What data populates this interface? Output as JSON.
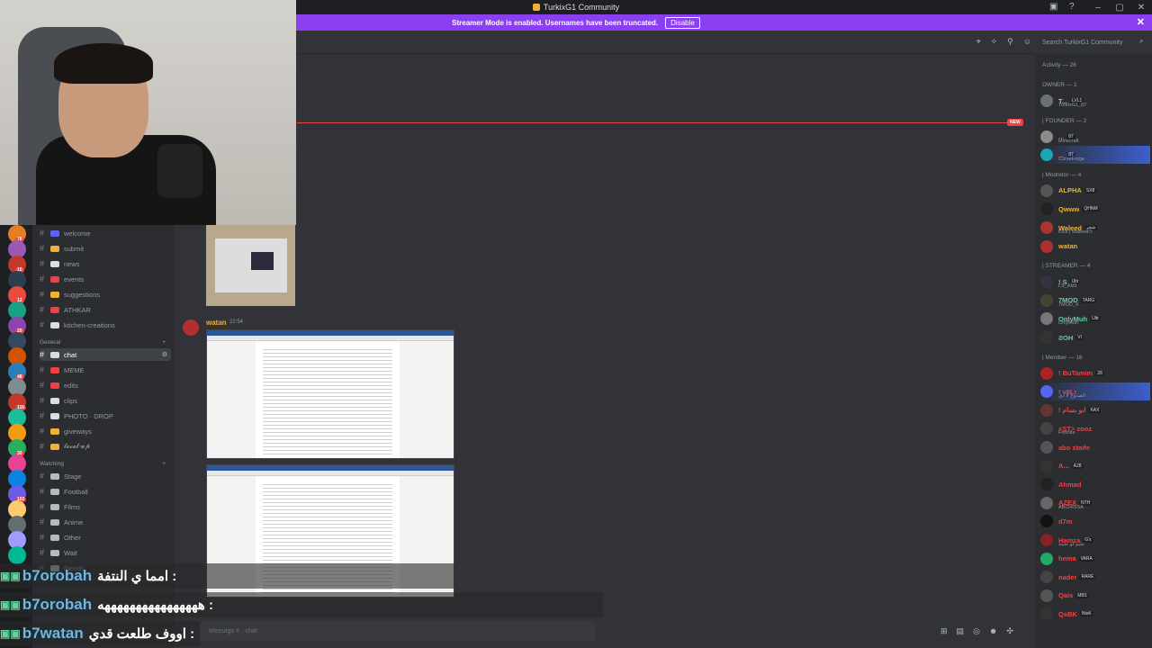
{
  "window": {
    "title": "TurkixG1 Community"
  },
  "banner": {
    "text": "Streamer Mode is enabled. Usernames have been truncated.",
    "button": "Disable"
  },
  "header": {
    "search_placeholder": "Search TurkixG1 Community"
  },
  "server_badges": [
    "78",
    "10",
    "12",
    "20",
    "48",
    "116",
    "30",
    "102"
  ],
  "channels": [
    {
      "name": "welcome",
      "color": "#5865f2"
    },
    {
      "name": "submit",
      "color": "#f0b232"
    },
    {
      "name": "news",
      "color": "#dbdee1"
    },
    {
      "name": "events",
      "color": "#f23f43"
    },
    {
      "name": "suggestions",
      "color": "#f0b232"
    },
    {
      "name": "ATHKAR",
      "color": "#f23f43"
    },
    {
      "name": "kitchen-creations",
      "color": "#dbdee1"
    }
  ],
  "category_general": "General",
  "general_channels": [
    {
      "name": "chat",
      "color": "#dbdee1",
      "active": true
    },
    {
      "name": "MEME",
      "color": "#f23f43"
    },
    {
      "name": "edits",
      "color": "#f23f43"
    },
    {
      "name": "clips",
      "color": "#dbdee1"
    },
    {
      "name": "PHOTO · DROP",
      "color": "#dbdee1"
    },
    {
      "name": "giveways",
      "color": "#f0b232"
    },
    {
      "name": "𝓵𝓮𝓿𝓮𝓵-𝓾𝓹",
      "color": "#f0b232"
    }
  ],
  "category_watching": "Watching",
  "watching_channels": [
    {
      "name": "Stage"
    },
    {
      "name": "Football"
    },
    {
      "name": "Films"
    },
    {
      "name": "Anime"
    },
    {
      "name": "Other"
    },
    {
      "name": "Wait"
    },
    {
      "name": "friends"
    }
  ],
  "message": {
    "author": "watan",
    "time": "22:54"
  },
  "new_badge": "NEW",
  "input_placeholder": "Message #  · chat",
  "members": {
    "activity": "Activity — 26",
    "groups": [
      {
        "label": "OWNER — 1",
        "members": [
          {
            "name": "T...",
            "tag": "LVL1",
            "sub": "TurkixG1_87",
            "color": "#b5bac1",
            "avatar": "#6d6f78"
          }
        ]
      },
      {
        "label": "| FOUNDER — 2",
        "members": [
          {
            "name": "...",
            "tag": "87",
            "sub": "Minecraft",
            "color": "#f23f43",
            "avatar": "#8a8a8a"
          },
          {
            "name": "...",
            "tag": "87",
            "sub": "CurseForge",
            "color": "#f23f43",
            "avatar": "#1aa5b0",
            "highlight": true
          }
        ]
      },
      {
        "label": "| Modretor — 4",
        "members": [
          {
            "name": "ALPHA",
            "tag": "SX8",
            "sub": "",
            "color": "#f0b232",
            "avatar": "#555"
          },
          {
            "name": "Qwww",
            "tag": "QHNM",
            "sub": "",
            "color": "#f0b232",
            "avatar": "#222"
          },
          {
            "name": "Waleed",
            "tag": "شجر",
            "sub": "Kick | Waleed7i",
            "color": "#f0b232",
            "avatar": "#a33"
          },
          {
            "name": "watan",
            "tag": "",
            "sub": "",
            "color": "#f0b232",
            "avatar": "#b03030"
          }
        ]
      },
      {
        "label": "| STREAMER — 4",
        "members": [
          {
            "name": "! S",
            "tag": "Ultr",
            "sub": "LS_AM1",
            "color": "#5dd39e",
            "avatar": "#334"
          },
          {
            "name": "7MOD",
            "tag": "TARG",
            "sub": "7MOD_4",
            "color": "#5dd39e",
            "avatar": "#443"
          },
          {
            "name": "OnlyMuh",
            "tag": "Ultr",
            "sub": "OnlyMuh",
            "color": "#5dd39e",
            "avatar": "#777"
          },
          {
            "name": "ƧOH",
            "tag": "VI",
            "sub": "",
            "color": "#5dd39e",
            "avatar": "#333"
          }
        ]
      },
      {
        "label": "| Member — 16",
        "members": [
          {
            "name": "! BuTamim",
            "tag": "28",
            "sub": "",
            "color": "#f23f43",
            "avatar": "#a22"
          },
          {
            "name": "! v8Lr",
            "tag": "",
            "sub": "الصدوح لا دي",
            "color": "#f23f43",
            "avatar": "#5865f2",
            "highlight": true
          },
          {
            "name": "! ابو بسام",
            "tag": "KAX",
            "sub": "",
            "color": "#f23f43",
            "avatar": "#633"
          },
          {
            "name": "<ST> zooz",
            "tag": "",
            "sub": "Fortnite",
            "color": "#f23f43",
            "avatar": "#444"
          },
          {
            "name": "abo staife",
            "tag": "",
            "sub": "",
            "color": "#f23f43",
            "avatar": "#555"
          },
          {
            "name": "A...",
            "tag": "A28",
            "sub": "",
            "color": "#f23f43",
            "avatar": "#333"
          },
          {
            "name": "Ahmad",
            "tag": "",
            "sub": "",
            "color": "#f23f43",
            "avatar": "#222"
          },
          {
            "name": "AZEX",
            "tag": "NTH",
            "sub": "ABCHISSA",
            "color": "#f23f43",
            "avatar": "#666"
          },
          {
            "name": "d7m",
            "tag": "",
            "sub": "",
            "color": "#f23f43",
            "avatar": "#111"
          },
          {
            "name": "Hamza",
            "tag": "G's",
            "sub": "تبليم لو نجمة",
            "color": "#f23f43",
            "avatar": "#822"
          },
          {
            "name": "hema",
            "tag": "VARA",
            "sub": "",
            "color": "#f23f43",
            "avatar": "#2a6"
          },
          {
            "name": "nader",
            "tag": "RARE",
            "sub": "",
            "color": "#f23f43",
            "avatar": "#444"
          },
          {
            "name": "Qais",
            "tag": "M8S",
            "sub": "",
            "color": "#f23f43",
            "avatar": "#555"
          },
          {
            "name": "QxBK",
            "tag": "NtsK",
            "sub": "",
            "color": "#f23f43",
            "avatar": "#333"
          }
        ]
      }
    ]
  },
  "overlay_chat": [
    {
      "user": "b7orobah",
      "text": ": امما ي النتفة"
    },
    {
      "user": "b7orobah",
      "text": ": ههههههههههههههههه"
    },
    {
      "user": "b7watan",
      "text": ": اووف طلعت قدي"
    }
  ]
}
